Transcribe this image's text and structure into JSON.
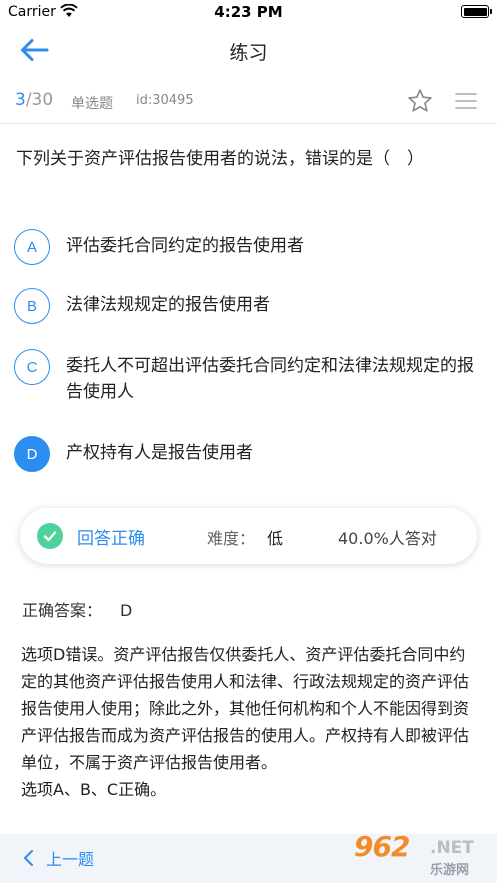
{
  "status_bar": {
    "carrier": "Carrier",
    "time": "4:23 PM"
  },
  "nav": {
    "title": "练习"
  },
  "question_meta": {
    "current": "3",
    "total": "/30",
    "type": "单选题",
    "id": "id:30495"
  },
  "question": {
    "text": "下列关于资产评估报告使用者的说法，错误的是（　）"
  },
  "options": [
    {
      "letter": "A",
      "text": "评估委托合同约定的报告使用者",
      "selected": false
    },
    {
      "letter": "B",
      "text": "法律法规规定的报告使用者",
      "selected": false
    },
    {
      "letter": "C",
      "text": "委托人不可超出评估委托合同约定和法律法规规定的报告使用人",
      "selected": false
    },
    {
      "letter": "D",
      "text": "产权持有人是报告使用者",
      "selected": true
    }
  ],
  "result": {
    "status": "回答正确",
    "difficulty_label": "难度：",
    "difficulty_value": "低",
    "accuracy": "40.0%人答对"
  },
  "answer": {
    "label": "正确答案：",
    "value": "D"
  },
  "explanation": {
    "line1": "选项D错误。资产评估报告仅供委托人、资产评估委托合同中约定的其他资产评估报告使用人和法律、行政法规规定的资产评估报告使用人使用；除此之外，其他任何机构和个人不能因得到资产评估报告而成为资产评估报告的使用人。产权持有人即被评估单位，不属于资产评估报告使用者。",
    "line2": "选项A、B、C正确。"
  },
  "bottom_bar": {
    "prev_label": "上一题"
  },
  "watermark": {
    "number": "962",
    "suffix": ".NET",
    "cn": "乐游网"
  },
  "colors": {
    "accent": "#2d8cf0",
    "success": "#4cd29a",
    "bottom_bar_bg": "#f1f5fa",
    "watermark_orange": "#f28c28"
  },
  "icons": [
    "wifi-icon",
    "battery-icon",
    "back-arrow-icon",
    "star-icon",
    "list-menu-icon",
    "check-circle-icon",
    "chevron-left-icon"
  ]
}
